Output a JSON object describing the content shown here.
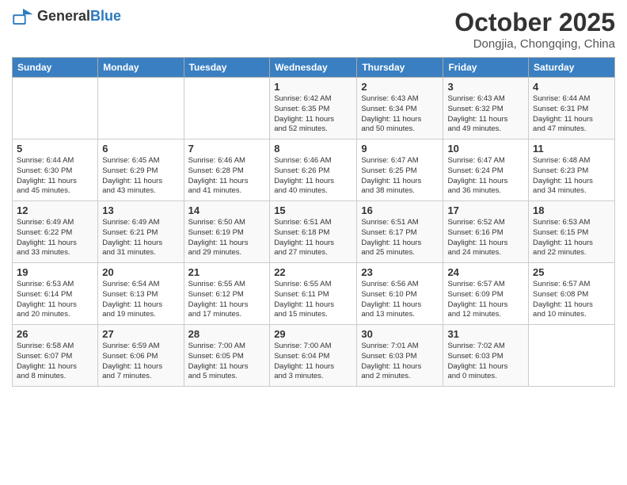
{
  "header": {
    "logo_general": "General",
    "logo_blue": "Blue",
    "month": "October 2025",
    "location": "Dongjia, Chongqing, China"
  },
  "weekdays": [
    "Sunday",
    "Monday",
    "Tuesday",
    "Wednesday",
    "Thursday",
    "Friday",
    "Saturday"
  ],
  "weeks": [
    [
      {
        "day": "",
        "detail": ""
      },
      {
        "day": "",
        "detail": ""
      },
      {
        "day": "",
        "detail": ""
      },
      {
        "day": "1",
        "detail": "Sunrise: 6:42 AM\nSunset: 6:35 PM\nDaylight: 11 hours\nand 52 minutes."
      },
      {
        "day": "2",
        "detail": "Sunrise: 6:43 AM\nSunset: 6:34 PM\nDaylight: 11 hours\nand 50 minutes."
      },
      {
        "day": "3",
        "detail": "Sunrise: 6:43 AM\nSunset: 6:32 PM\nDaylight: 11 hours\nand 49 minutes."
      },
      {
        "day": "4",
        "detail": "Sunrise: 6:44 AM\nSunset: 6:31 PM\nDaylight: 11 hours\nand 47 minutes."
      }
    ],
    [
      {
        "day": "5",
        "detail": "Sunrise: 6:44 AM\nSunset: 6:30 PM\nDaylight: 11 hours\nand 45 minutes."
      },
      {
        "day": "6",
        "detail": "Sunrise: 6:45 AM\nSunset: 6:29 PM\nDaylight: 11 hours\nand 43 minutes."
      },
      {
        "day": "7",
        "detail": "Sunrise: 6:46 AM\nSunset: 6:28 PM\nDaylight: 11 hours\nand 41 minutes."
      },
      {
        "day": "8",
        "detail": "Sunrise: 6:46 AM\nSunset: 6:26 PM\nDaylight: 11 hours\nand 40 minutes."
      },
      {
        "day": "9",
        "detail": "Sunrise: 6:47 AM\nSunset: 6:25 PM\nDaylight: 11 hours\nand 38 minutes."
      },
      {
        "day": "10",
        "detail": "Sunrise: 6:47 AM\nSunset: 6:24 PM\nDaylight: 11 hours\nand 36 minutes."
      },
      {
        "day": "11",
        "detail": "Sunrise: 6:48 AM\nSunset: 6:23 PM\nDaylight: 11 hours\nand 34 minutes."
      }
    ],
    [
      {
        "day": "12",
        "detail": "Sunrise: 6:49 AM\nSunset: 6:22 PM\nDaylight: 11 hours\nand 33 minutes."
      },
      {
        "day": "13",
        "detail": "Sunrise: 6:49 AM\nSunset: 6:21 PM\nDaylight: 11 hours\nand 31 minutes."
      },
      {
        "day": "14",
        "detail": "Sunrise: 6:50 AM\nSunset: 6:19 PM\nDaylight: 11 hours\nand 29 minutes."
      },
      {
        "day": "15",
        "detail": "Sunrise: 6:51 AM\nSunset: 6:18 PM\nDaylight: 11 hours\nand 27 minutes."
      },
      {
        "day": "16",
        "detail": "Sunrise: 6:51 AM\nSunset: 6:17 PM\nDaylight: 11 hours\nand 25 minutes."
      },
      {
        "day": "17",
        "detail": "Sunrise: 6:52 AM\nSunset: 6:16 PM\nDaylight: 11 hours\nand 24 minutes."
      },
      {
        "day": "18",
        "detail": "Sunrise: 6:53 AM\nSunset: 6:15 PM\nDaylight: 11 hours\nand 22 minutes."
      }
    ],
    [
      {
        "day": "19",
        "detail": "Sunrise: 6:53 AM\nSunset: 6:14 PM\nDaylight: 11 hours\nand 20 minutes."
      },
      {
        "day": "20",
        "detail": "Sunrise: 6:54 AM\nSunset: 6:13 PM\nDaylight: 11 hours\nand 19 minutes."
      },
      {
        "day": "21",
        "detail": "Sunrise: 6:55 AM\nSunset: 6:12 PM\nDaylight: 11 hours\nand 17 minutes."
      },
      {
        "day": "22",
        "detail": "Sunrise: 6:55 AM\nSunset: 6:11 PM\nDaylight: 11 hours\nand 15 minutes."
      },
      {
        "day": "23",
        "detail": "Sunrise: 6:56 AM\nSunset: 6:10 PM\nDaylight: 11 hours\nand 13 minutes."
      },
      {
        "day": "24",
        "detail": "Sunrise: 6:57 AM\nSunset: 6:09 PM\nDaylight: 11 hours\nand 12 minutes."
      },
      {
        "day": "25",
        "detail": "Sunrise: 6:57 AM\nSunset: 6:08 PM\nDaylight: 11 hours\nand 10 minutes."
      }
    ],
    [
      {
        "day": "26",
        "detail": "Sunrise: 6:58 AM\nSunset: 6:07 PM\nDaylight: 11 hours\nand 8 minutes."
      },
      {
        "day": "27",
        "detail": "Sunrise: 6:59 AM\nSunset: 6:06 PM\nDaylight: 11 hours\nand 7 minutes."
      },
      {
        "day": "28",
        "detail": "Sunrise: 7:00 AM\nSunset: 6:05 PM\nDaylight: 11 hours\nand 5 minutes."
      },
      {
        "day": "29",
        "detail": "Sunrise: 7:00 AM\nSunset: 6:04 PM\nDaylight: 11 hours\nand 3 minutes."
      },
      {
        "day": "30",
        "detail": "Sunrise: 7:01 AM\nSunset: 6:03 PM\nDaylight: 11 hours\nand 2 minutes."
      },
      {
        "day": "31",
        "detail": "Sunrise: 7:02 AM\nSunset: 6:03 PM\nDaylight: 11 hours\nand 0 minutes."
      },
      {
        "day": "",
        "detail": ""
      }
    ]
  ]
}
